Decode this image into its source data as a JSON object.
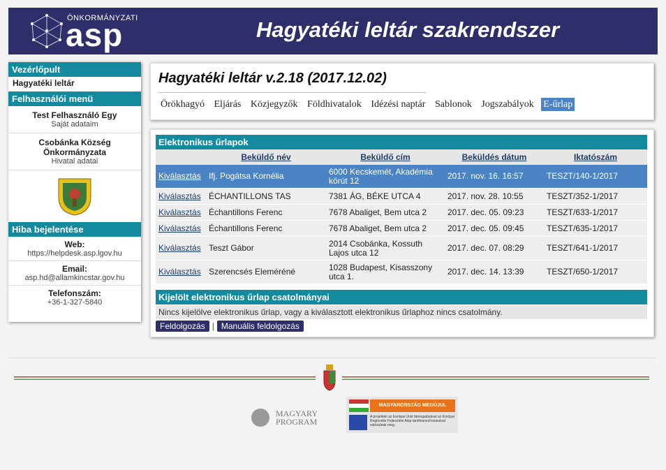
{
  "header": {
    "logo_small": "ÖNKORMÁNYZATI",
    "logo_big": "asp",
    "app_title": "Hagyatéki leltár szakrendszer"
  },
  "sidebar": {
    "vezerlopult": "Vezérlőpult",
    "vezerlopult_link": "Hagyatéki leltár",
    "user_menu": "Felhasználói menü",
    "user_name": "Test Felhasználó Egy",
    "user_link": "Saját adataim",
    "office_name": "Csobánka Község Önkormányzata",
    "office_link": "Hivatal adatai",
    "error_report": "Hiba bejelentése",
    "web_label": "Web:",
    "web_value": "https://helpdesk.asp.lgov.hu",
    "email_label": "Email:",
    "email_value": "asp.hd@allamkincstar.gov.hu",
    "phone_label": "Telefonszám:",
    "phone_value": "+36-1-327-5840"
  },
  "main": {
    "title": "Hagyatéki leltár v.2.18 (2017.12.02)",
    "menu": [
      "Örökhagyó",
      "Eljárás",
      "Közjegyzők",
      "Földhivatalok",
      "Idézési naptár",
      "Sablonok",
      "Jogszabályok",
      "E-űrlap"
    ]
  },
  "forms": {
    "heading": "Elektronikus űrlapok",
    "columns": [
      "",
      "Beküldő név",
      "Beküldő cím",
      "Beküldés dátum",
      "Iktatószám"
    ],
    "rows": [
      {
        "action": "Kiválasztás",
        "name": "Ifj. Pogátsa Kornélia",
        "address": "6000 Kecskemét, Akadémia körút 12",
        "date": "2017. nov. 16. 16:57",
        "id": "TESZT/140-1/2017"
      },
      {
        "action": "Kiválasztás",
        "name": "ÉCHANTILLONS TAS",
        "address": "7381 ÁG, BÉKE UTCA 4",
        "date": "2017. nov. 28. 10:55",
        "id": "TESZT/352-1/2017"
      },
      {
        "action": "Kiválasztás",
        "name": "Échantillons Ferenc",
        "address": "7678 Abaliget, Bem utca 2",
        "date": "2017. dec. 05. 09:23",
        "id": "TESZT/633-1/2017"
      },
      {
        "action": "Kiválasztás",
        "name": "Échantillons Ferenc",
        "address": "7678 Abaliget, Bem utca 2",
        "date": "2017. dec. 05. 09:45",
        "id": "TESZT/635-1/2017"
      },
      {
        "action": "Kiválasztás",
        "name": "Teszt Gábor",
        "address": "2014 Csobánka, Kossuth Lajos utca 12",
        "date": "2017. dec. 07. 08:29",
        "id": "TESZT/641-1/2017"
      },
      {
        "action": "Kiválasztás",
        "name": "Szerencsés Eleméréné",
        "address": "1028 Budapest, Kisasszony utca 1.",
        "date": "2017. dec. 14. 13:39",
        "id": "TESZT/650-1/2017"
      }
    ],
    "attachments_heading": "Kijelölt elektronikus űrlap csatolmányai",
    "attachments_note": "Nincs kijelölve elektronikus űrlap, vagy a kiválasztott elektronikus űrlaphoz nincs csatolmány.",
    "btn_process": "Feldolgozás",
    "btn_manual": "Manuális feldolgozás",
    "separator": "|"
  },
  "footer": {
    "magyary_line1": "MAGYARY",
    "magyary_line2": "PROGRAM",
    "hu_banner": "MAGYARORSZÁG MEGÚJUL",
    "hu_text": "A projektek az Európai Unió támogatásával az Európai Regionális Fejlesztési Alap társfinanszírozásával valósulnak meg."
  }
}
